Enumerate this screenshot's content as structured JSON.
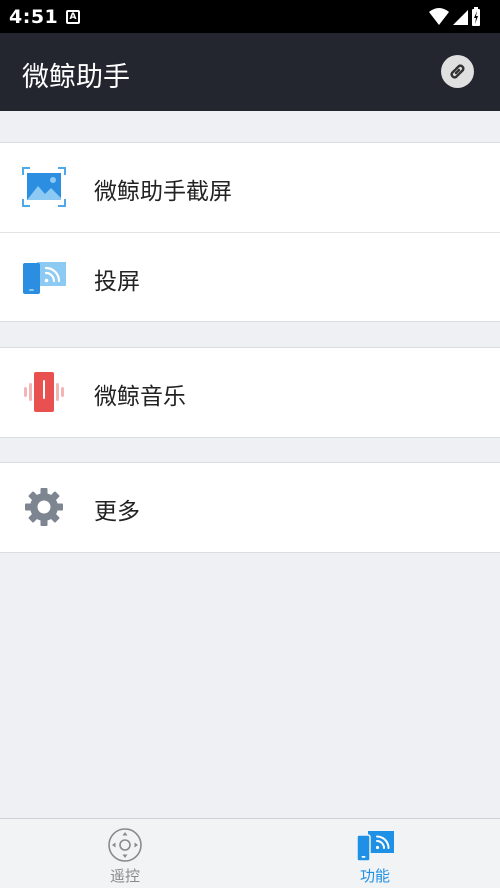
{
  "status_bar": {
    "time": "4:51",
    "badge": "A"
  },
  "app_bar": {
    "title": "微鲸助手"
  },
  "menu": {
    "screenshot": "微鲸助手截屏",
    "cast": "投屏",
    "music": "微鲸音乐",
    "more": "更多"
  },
  "bottom_nav": {
    "items": [
      {
        "label": "遥控",
        "icon": "remote-control-icon",
        "selected": false
      },
      {
        "label": "功能",
        "icon": "cast-function-icon",
        "selected": true
      }
    ]
  },
  "colors": {
    "app_bar_bg": "#23262f",
    "background": "#eff0f4",
    "accent": "#1e90e6",
    "music_red": "#e8514f",
    "gear_gray": "#7d8590"
  }
}
